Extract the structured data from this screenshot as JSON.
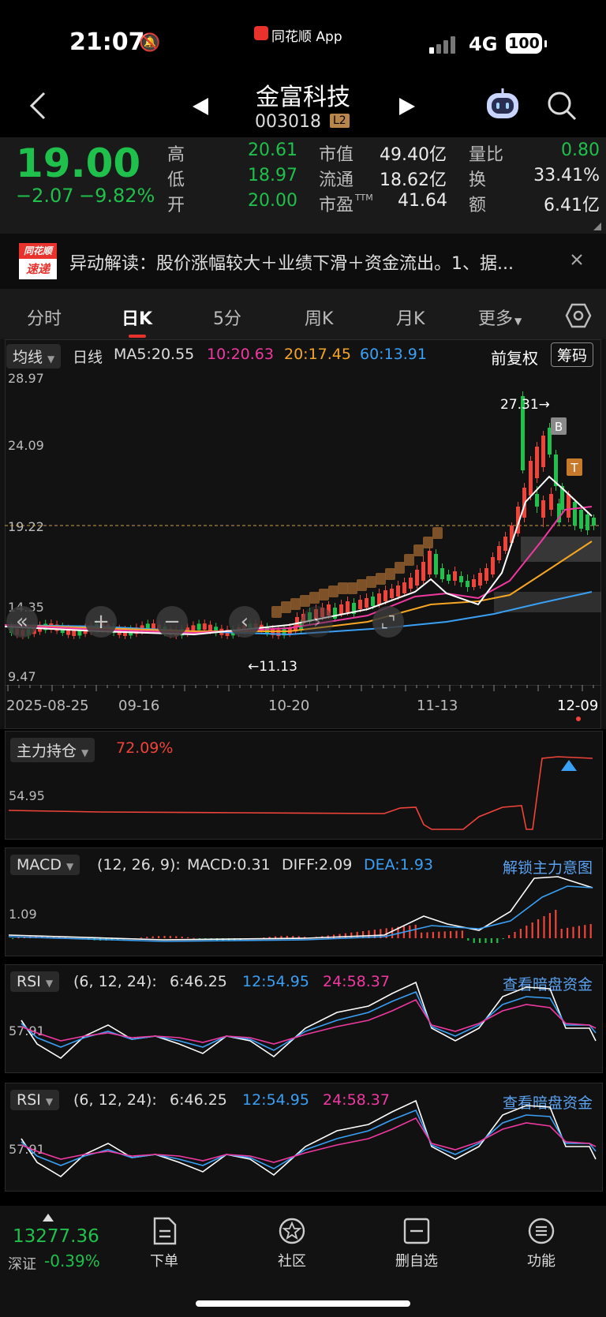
{
  "status": {
    "time": "21:07",
    "app_label": "同花顺 App",
    "network": "4G",
    "battery": "100"
  },
  "nav": {
    "name": "金富科技",
    "code": "003018",
    "level": "L2"
  },
  "quote": {
    "price": "19.00",
    "change": "−2.07",
    "change_pct": "−9.82%",
    "high_label": "高",
    "high": "20.61",
    "low_label": "低",
    "low": "18.97",
    "open_label": "开",
    "open": "20.00",
    "mcap_label": "市值",
    "mcap": "49.40亿",
    "float_label": "流通",
    "float": "18.62亿",
    "pe_label": "市盈",
    "pe_sup": "TTM",
    "pe": "41.64",
    "vr_label": "量比",
    "vr": "0.80",
    "turn_label": "换",
    "turn": "33.41%",
    "amt_label": "额",
    "amt": "6.41亿"
  },
  "news": {
    "badge_top": "同花顺",
    "badge_bottom": "速递",
    "text": "异动解读：股价涨幅较大＋业绩下滑＋资金流出。1、据..."
  },
  "tabs": [
    {
      "label": "分时",
      "active": false
    },
    {
      "label": "日K",
      "active": true
    },
    {
      "label": "5分",
      "active": false
    },
    {
      "label": "周K",
      "active": false
    },
    {
      "label": "月K",
      "active": false
    },
    {
      "label": "更多",
      "active": false
    }
  ],
  "kline": {
    "indicator": "均线",
    "period": "日线",
    "ma5": "MA5:20.55",
    "ma10": "10:20.63",
    "ma20": "20:17.45",
    "ma60": "60:13.91",
    "adjust": "前复权",
    "chip": "筹码",
    "y_labels": [
      "28.97",
      "24.09",
      "19.22",
      "14.35",
      "9.47"
    ],
    "high_mark": "27.31→",
    "low_mark": "←11.13",
    "x_labels": [
      "2025-08-25",
      "09-16",
      "10-20",
      "11-13",
      "12-09"
    ],
    "signal_b": "B",
    "signal_t": "T",
    "colors": {
      "up": "#f0443a",
      "down": "#1fc04b",
      "ma5": "#ffffff",
      "ma10": "#f039a0",
      "ma20": "#f5a623",
      "ma60": "#3aa0f5"
    }
  },
  "holding": {
    "label": "主力持仓",
    "value": "72.09%",
    "y_label": "54.95"
  },
  "macd": {
    "label": "MACD",
    "params": "(12, 26, 9):",
    "macd": "MACD:0.31",
    "diff": "DIFF:2.09",
    "dea": "DEA:1.93",
    "link": "解锁主力意图",
    "y_label": "1.09"
  },
  "rsi1": {
    "label": "RSI",
    "params": "(6, 12, 24):",
    "r6": "6:46.25",
    "r12": "12:54.95",
    "r24": "24:58.37",
    "link": "查看暗盘资金",
    "y_label": "57.91"
  },
  "rsi2": {
    "label": "RSI",
    "params": "(6, 12, 24):",
    "r6": "6:46.25",
    "r12": "12:54.95",
    "r24": "24:58.37",
    "link": "查看暗盘资金",
    "y_label": "57.91"
  },
  "bottom": {
    "index_value": "13277.36",
    "index_name": "深证",
    "index_change": "-0.39%",
    "items": [
      {
        "label": "下单"
      },
      {
        "label": "社区"
      },
      {
        "label": "删自选"
      },
      {
        "label": "功能"
      }
    ]
  }
}
